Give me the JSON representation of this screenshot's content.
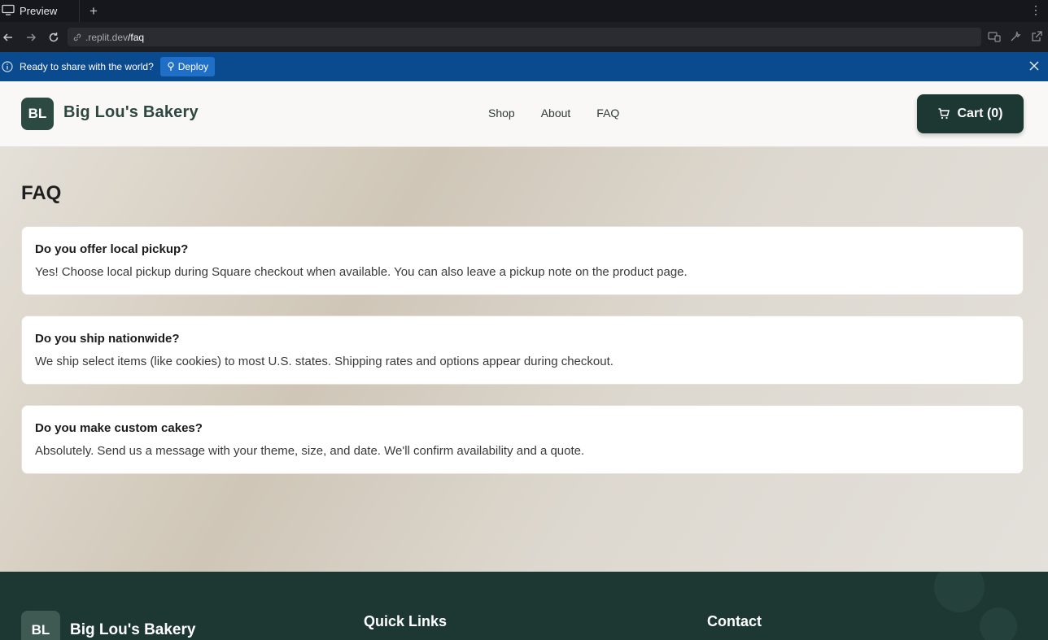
{
  "browser": {
    "tab_label": "Preview",
    "new_tab": "+",
    "url_host": ".replit.dev",
    "url_path": "/faq",
    "banner_text": "Ready to share with the world?",
    "deploy_label": "Deploy"
  },
  "header": {
    "logo_initials": "BL",
    "brand": "Big Lou's Bakery",
    "nav": [
      "Shop",
      "About",
      "FAQ"
    ],
    "cart_label": "Cart (0)"
  },
  "main": {
    "title": "FAQ",
    "faqs": [
      {
        "q": "Do you offer local pickup?",
        "a": "Yes! Choose local pickup during Square checkout when available. You can also leave a pickup note on the product page."
      },
      {
        "q": "Do you ship nationwide?",
        "a": "We ship select items (like cookies) to most U.S. states. Shipping rates and options appear during checkout."
      },
      {
        "q": "Do you make custom cakes?",
        "a": "Absolutely. Send us a message with your theme, size, and date. We'll confirm availability and a quote."
      }
    ]
  },
  "footer": {
    "logo_initials": "BL",
    "brand": "Big Lou's Bakery",
    "quick_links_heading": "Quick Links",
    "contact_heading": "Contact"
  },
  "colors": {
    "brand_dark": "#1d3833",
    "banner_blue": "#0a4a8f"
  }
}
